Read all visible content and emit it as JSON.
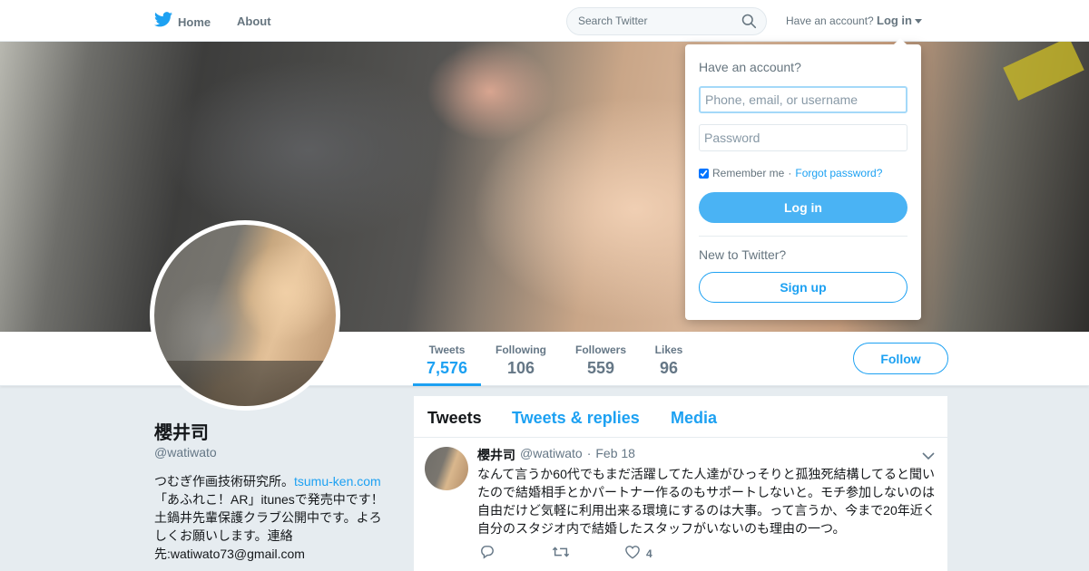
{
  "nav": {
    "home_label": "Home",
    "about_label": "About",
    "search_placeholder": "Search Twitter",
    "have_account": "Have an account?",
    "login_label": "Log in",
    "brand_color": "#1da1f2"
  },
  "profile": {
    "name": "櫻井司",
    "handle": "@watiwato",
    "bio_before_link": "つむぎ作画技術研究所。",
    "bio_link": "tsumu-ken.com",
    "bio_after_link": "「あふれこ！AR」itunesで発売中です！ 土鍋井先輩保護クラブ公開中です。よろしくお願いします。連絡先:watiwato73@gmail.com"
  },
  "stats": [
    {
      "label": "Tweets",
      "value": "7,576"
    },
    {
      "label": "Following",
      "value": "106"
    },
    {
      "label": "Followers",
      "value": "559"
    },
    {
      "label": "Likes",
      "value": "96"
    }
  ],
  "follow_label": "Follow",
  "timeline": {
    "tabs": [
      "Tweets",
      "Tweets & replies",
      "Media"
    ],
    "tweet": {
      "name": "櫻井司",
      "handle": "@watiwato",
      "dot": "·",
      "date": "Feb 18",
      "text": "なんて言うか60代でもまだ活躍してた人達がひっそりと孤独死結構してると聞いたので結婚相手とかパートナー作るのもサポートしないと。モチ参加しないのは自由だけど気軽に利用出来る環境にするのは大事。って言うか、今まで20年近く自分のスタジオ内で結婚したスタッフがいないのも理由の一つ。",
      "likes": "4"
    }
  },
  "login_dropdown": {
    "title": "Have an account?",
    "username_placeholder": "Phone, email, or username",
    "password_placeholder": "Password",
    "remember_label": "Remember me",
    "separator": "·",
    "forgot_label": "Forgot password?",
    "login_button": "Log in",
    "new_label": "New to Twitter?",
    "signup_button": "Sign up"
  }
}
